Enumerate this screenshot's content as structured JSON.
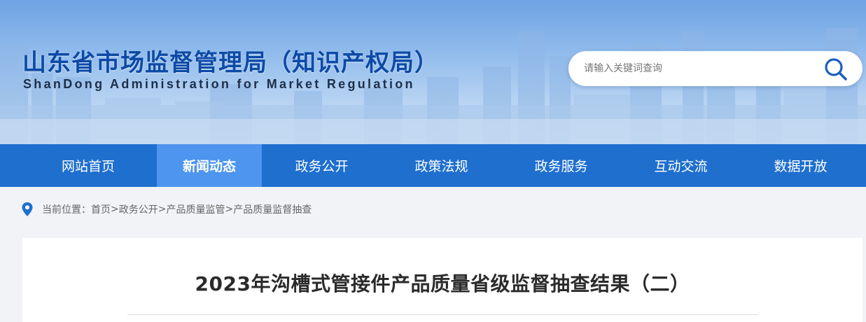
{
  "header": {
    "title": "山东省市场监督管理局（知识产权局）",
    "subtitle": "ShanDong Administration for Market Regulation"
  },
  "search": {
    "placeholder": "请输入关键词查询",
    "icon": "search-icon"
  },
  "nav": {
    "items": [
      {
        "label": "网站首页",
        "active": false
      },
      {
        "label": "新闻动态",
        "active": true
      },
      {
        "label": "政务公开",
        "active": false
      },
      {
        "label": "政策法规",
        "active": false
      },
      {
        "label": "政务服务",
        "active": false
      },
      {
        "label": "互动交流",
        "active": false
      },
      {
        "label": "数据开放",
        "active": false
      }
    ]
  },
  "breadcrumb": {
    "icon": "location-pin-icon",
    "prefix": "当前位置：",
    "items": [
      "首页",
      "政务公开",
      "产品质量监管",
      "产品质量监督抽查"
    ],
    "separator": ">"
  },
  "article": {
    "title": "2023年沟槽式管接件产品质量省级监督抽查结果（二）"
  },
  "colors": {
    "nav_bg": "#1f6fcf",
    "nav_active": "#4d95ee",
    "title_blue": "#0d4aa6"
  }
}
